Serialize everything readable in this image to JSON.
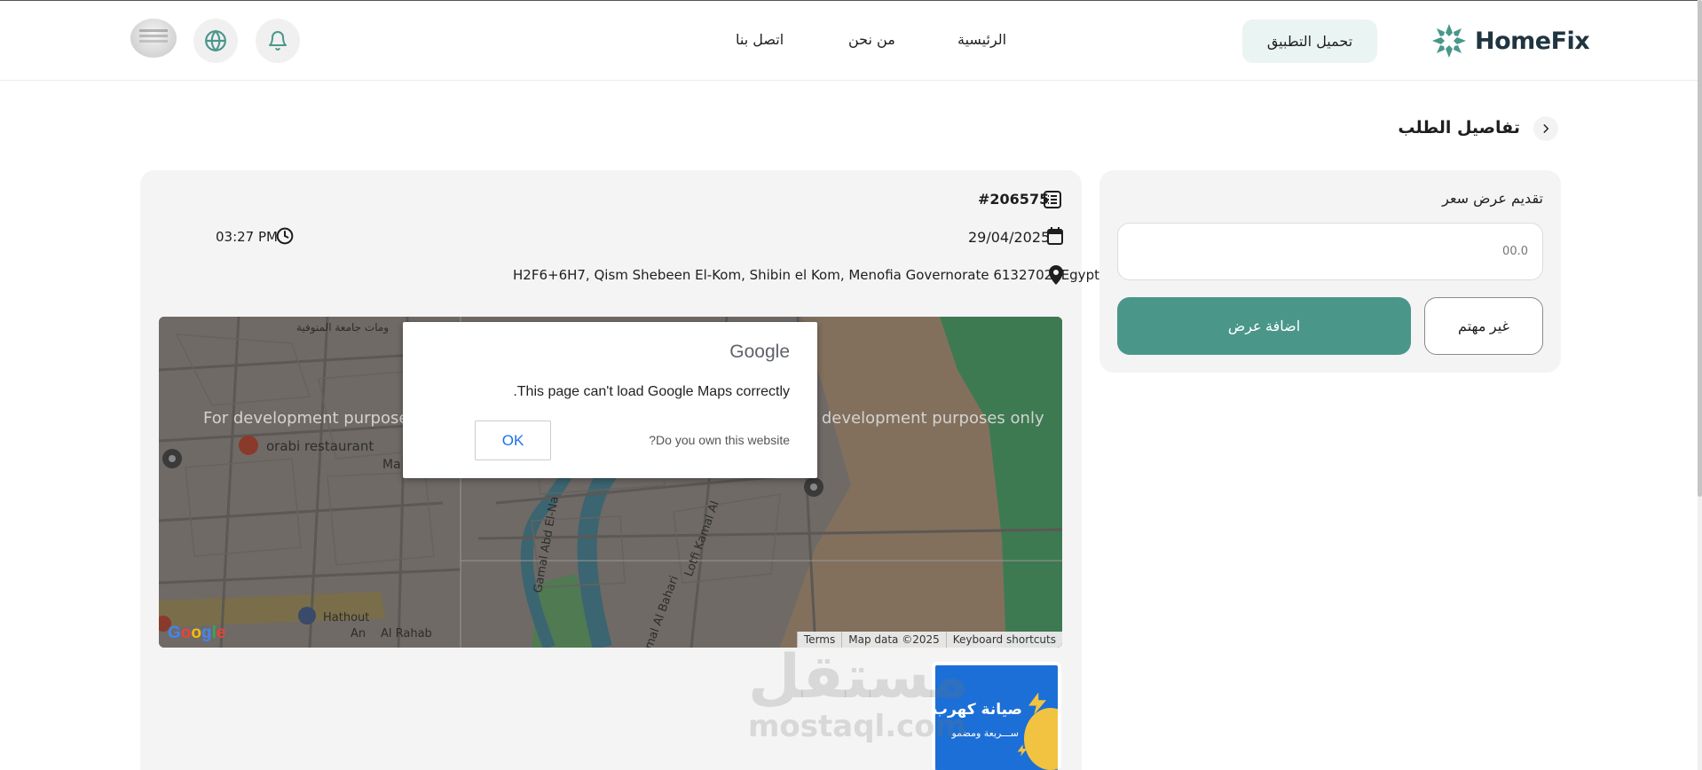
{
  "header": {
    "logo_text": "HomeFix",
    "download_app": "تحميل التطبيق",
    "nav": [
      "الرئيسية",
      "من نحن",
      "اتصل بنا"
    ],
    "icons": [
      "bell-icon",
      "globe-icon"
    ],
    "brand_color": "#4a978a"
  },
  "page": {
    "title": "تفاصيل الطلب"
  },
  "offer": {
    "title": "تقديم عرض سعر",
    "price_placeholder": "00.0",
    "add_offer": "اضافة عرض",
    "not_interested": "غير مهتم"
  },
  "order": {
    "id": "#206575",
    "date": "29/04/2025",
    "time": "03:27 PM",
    "address": "H2F6+6H7, Qism Shebeen El-Kom, Shibin el Kom, Menofia Governorate 6132702, Egypt"
  },
  "map": {
    "dev_text": "For development purposes only",
    "labels": [
      "orabi restaurant",
      "Hathout",
      "Al Rahab",
      "Gamal Abd El-Na",
      "Lotfi Kamal Al",
      "mal Al Bahari",
      "Ma",
      "An",
      "ومات جامعة المنوفية"
    ],
    "footer": [
      "Keyboard shortcuts",
      "Map data ©2025",
      "Terms"
    ],
    "google_logo": "Google",
    "dialog": {
      "brand": "Google",
      "message": "This page can't load Google Maps correctly.",
      "question": "Do you own this website?",
      "ok": "OK"
    }
  },
  "thumbnail": {
    "title": "صيانة كهرب",
    "subtitle": "ســـريعة ومضمو"
  },
  "watermark": {
    "ar": "مستقل",
    "en": "mostaql.com"
  }
}
